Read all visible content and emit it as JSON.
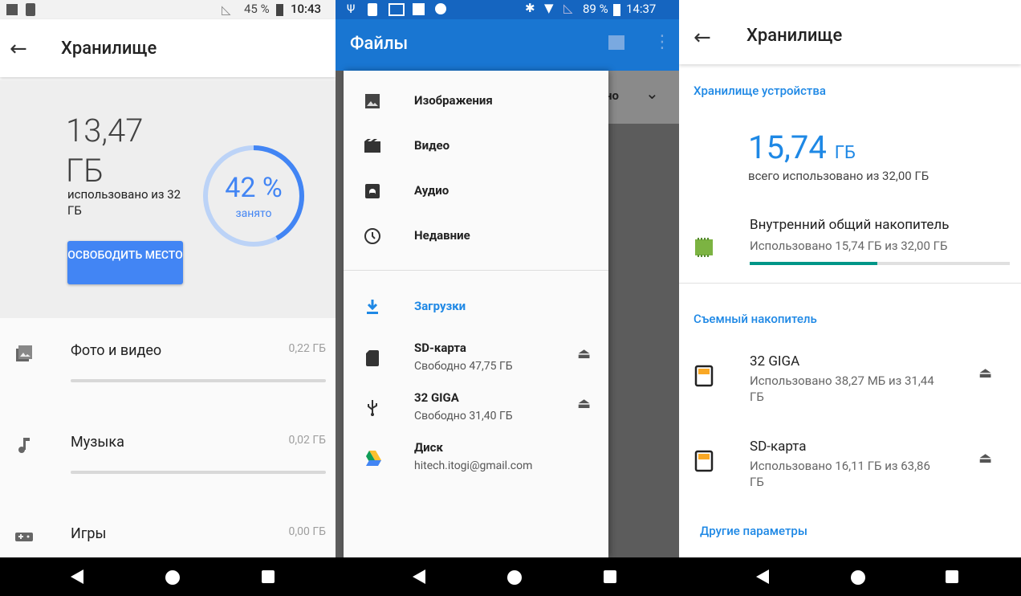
{
  "colors": {
    "accent": "#4285f4",
    "teal": "#009688",
    "appbar_blue": "#1976d2"
  },
  "left": {
    "status": {
      "battery": "45 %",
      "time": "10:43"
    },
    "title": "Хранилище",
    "summary": {
      "used_value": "13,47 ГБ",
      "used_of": "использовано из 32 ГБ",
      "percent": "42 %",
      "percent_label": "занято",
      "percent_fraction": 0.42,
      "free_button": "ОСВОБОДИТЬ МЕСТО"
    },
    "categories": [
      {
        "label": "Фото и видео",
        "value": "0,22 ГБ",
        "icon": "photo-icon"
      },
      {
        "label": "Музыка",
        "value": "0,02 ГБ",
        "icon": "music-note-icon"
      },
      {
        "label": "Игры",
        "value": "0,00 ГБ",
        "icon": "gamepad-icon"
      }
    ]
  },
  "middle": {
    "status": {
      "battery": "89 %",
      "time": "14:37"
    },
    "title": "Файлы",
    "behind_text": "но",
    "items": [
      {
        "label": "Изображения",
        "icon": "image-icon"
      },
      {
        "label": "Видео",
        "icon": "video-icon"
      },
      {
        "label": "Аудио",
        "icon": "audio-icon"
      },
      {
        "label": "Недавние",
        "icon": "clock-icon"
      }
    ],
    "locations": [
      {
        "label": "Загрузки",
        "icon": "download-icon"
      },
      {
        "label": "SD-карта",
        "sub": "Свободно 47,75 ГБ",
        "icon": "sd-card-icon"
      },
      {
        "label": "32 GIGA",
        "sub": "Свободно 31,40 ГБ",
        "icon": "usb-icon"
      },
      {
        "label": "Диск",
        "sub": "hitech.itogi@gmail.com",
        "icon": "drive-icon"
      }
    ]
  },
  "right": {
    "title": "Хранилище",
    "device_section": "Хранилище устройства",
    "used_value": "15,74",
    "used_unit": "ГБ",
    "total": "всего использовано из 32,00 ГБ",
    "internal": {
      "name": "Внутренний общий накопитель",
      "sub": "Использовано 15,74 ГБ из 32,00 ГБ",
      "fraction": 0.492
    },
    "removable_section": "Съемный накопитель",
    "removable": [
      {
        "name": "32 GIGA",
        "sub": "Использовано 38,27 МБ из 31,44 ГБ"
      },
      {
        "name": "SD-карта",
        "sub": "Использовано 16,11 ГБ из 63,86 ГБ"
      }
    ],
    "other": "Другие параметры"
  }
}
